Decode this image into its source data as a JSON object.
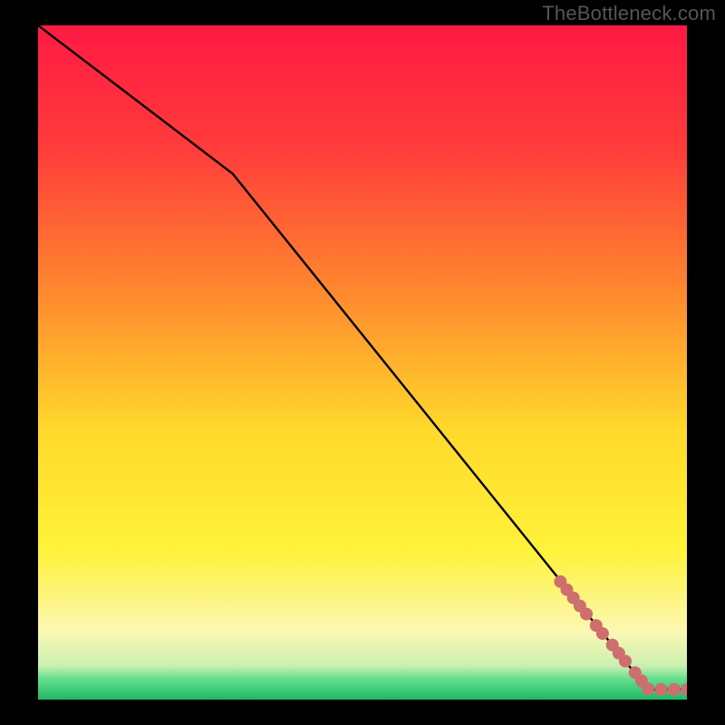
{
  "watermark": "TheBottleneck.com",
  "colors": {
    "frame": "#000000",
    "watermark": "#555555",
    "gradient_top": "#ff1a44",
    "gradient_mid_upper": "#ff7b33",
    "gradient_mid": "#ffe733",
    "gradient_lower": "#fff8a8",
    "gradient_green": "#22d36a",
    "line": "#000000",
    "marker": "#cf6e6e"
  },
  "chart_data": {
    "type": "line",
    "title": "",
    "xlabel": "",
    "ylabel": "",
    "xlim": [
      0,
      100
    ],
    "ylim": [
      0,
      100
    ],
    "grid": false,
    "series": [
      {
        "name": "curve",
        "x": [
          0,
          30,
          94,
          100
        ],
        "y": [
          100,
          78,
          1.5,
          1.5
        ]
      }
    ],
    "markers": {
      "name": "highlighted-points",
      "points": [
        {
          "x": 80.5,
          "y": 17.5
        },
        {
          "x": 81.5,
          "y": 16.3
        },
        {
          "x": 82.5,
          "y": 15.1
        },
        {
          "x": 83.5,
          "y": 13.9
        },
        {
          "x": 84.5,
          "y": 12.7
        },
        {
          "x": 86.0,
          "y": 11.0
        },
        {
          "x": 87.0,
          "y": 9.8
        },
        {
          "x": 88.5,
          "y": 8.1
        },
        {
          "x": 89.5,
          "y": 6.9
        },
        {
          "x": 90.5,
          "y": 5.7
        },
        {
          "x": 92.0,
          "y": 4.0
        },
        {
          "x": 93.0,
          "y": 2.8
        },
        {
          "x": 94.0,
          "y": 1.6
        },
        {
          "x": 96.0,
          "y": 1.5
        },
        {
          "x": 98.0,
          "y": 1.5
        },
        {
          "x": 100.0,
          "y": 1.5
        }
      ]
    }
  }
}
